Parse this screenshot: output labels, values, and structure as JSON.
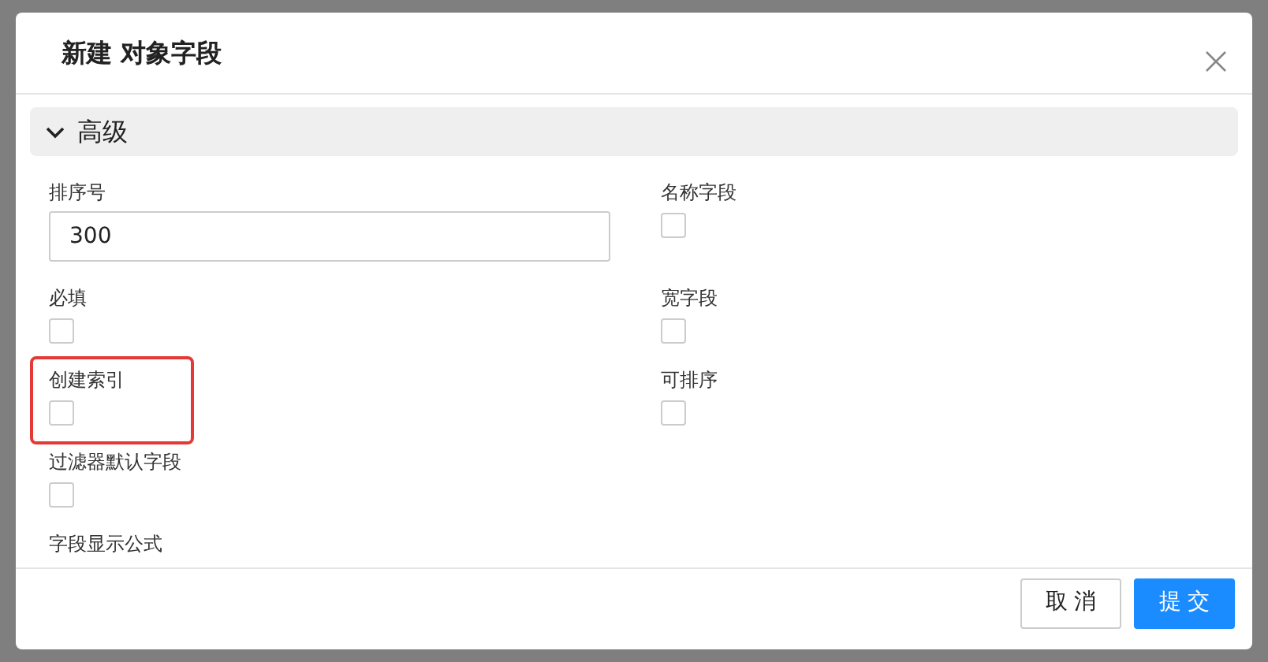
{
  "dialog": {
    "title": "新建 对象字段"
  },
  "section": {
    "title": "高级",
    "expanded": true
  },
  "rows": [
    [
      {
        "kind": "input",
        "label": "排序号",
        "value": "300"
      },
      {
        "kind": "checkbox",
        "label": "名称字段",
        "checked": false
      }
    ],
    [
      {
        "kind": "checkbox",
        "label": "必填",
        "checked": false
      },
      {
        "kind": "checkbox",
        "label": "宽字段",
        "checked": false
      }
    ],
    [
      {
        "kind": "checkbox",
        "label": "创建索引",
        "checked": false,
        "highlighted": true
      },
      {
        "kind": "checkbox",
        "label": "可排序",
        "checked": false
      }
    ],
    [
      {
        "kind": "checkbox",
        "label": "过滤器默认字段",
        "checked": false
      }
    ],
    [
      {
        "kind": "label",
        "label": "字段显示公式"
      }
    ]
  ],
  "buttons": [
    {
      "label": "取 消",
      "kind": "secondary"
    },
    {
      "label": "提 交",
      "kind": "primary"
    }
  ]
}
